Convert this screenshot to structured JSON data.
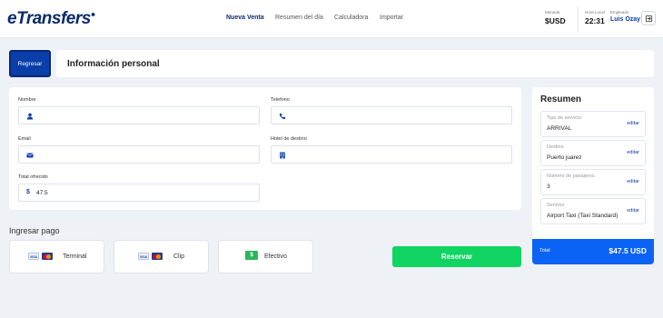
{
  "header": {
    "logo": "eTransfers",
    "nav": [
      "Nueva Venta",
      "Resumen del día",
      "Calculadora",
      "Importar"
    ],
    "moneda_label": "Moneda",
    "moneda_value": "$USD",
    "hora_label": "Hora Local",
    "hora_value": "22:31",
    "empleado_label": "Empleado",
    "empleado_value": "Luis Ozay"
  },
  "toolbar": {
    "back_label": "Regresar",
    "title": "Información personal"
  },
  "form": {
    "nombre_label": "Nombre",
    "nombre_value": "",
    "telefono_label": "Telefono",
    "telefono_value": "",
    "email_label": "Email",
    "email_value": "",
    "hotel_label": "Hotel de destino",
    "hotel_value": "",
    "total_label": "Total ofrecido",
    "total_value": "47.5",
    "currency_symbol": "$"
  },
  "payment": {
    "title": "Ingresar pago",
    "options": [
      "Terminal",
      "Clip",
      "Efectivo"
    ],
    "reserve_label": "Reservar"
  },
  "summary": {
    "title": "Resumen",
    "edit_label": "editar",
    "items": [
      {
        "label": "Tipo de servicio",
        "value": "ARRIVAL"
      },
      {
        "label": "Destino",
        "value": "Puerto juarez"
      },
      {
        "label": "Número de pasajeros",
        "value": "3"
      },
      {
        "label": "Servicio",
        "value": "Airport Taxi (Taxi Standard)"
      }
    ],
    "total_label": "Total",
    "total_value": "$47.5 USD"
  },
  "colors": {
    "brand": "#0a2a6b",
    "primary": "#0a3ea8",
    "reserve": "#10d562",
    "total_bar": "#0b63f6"
  }
}
